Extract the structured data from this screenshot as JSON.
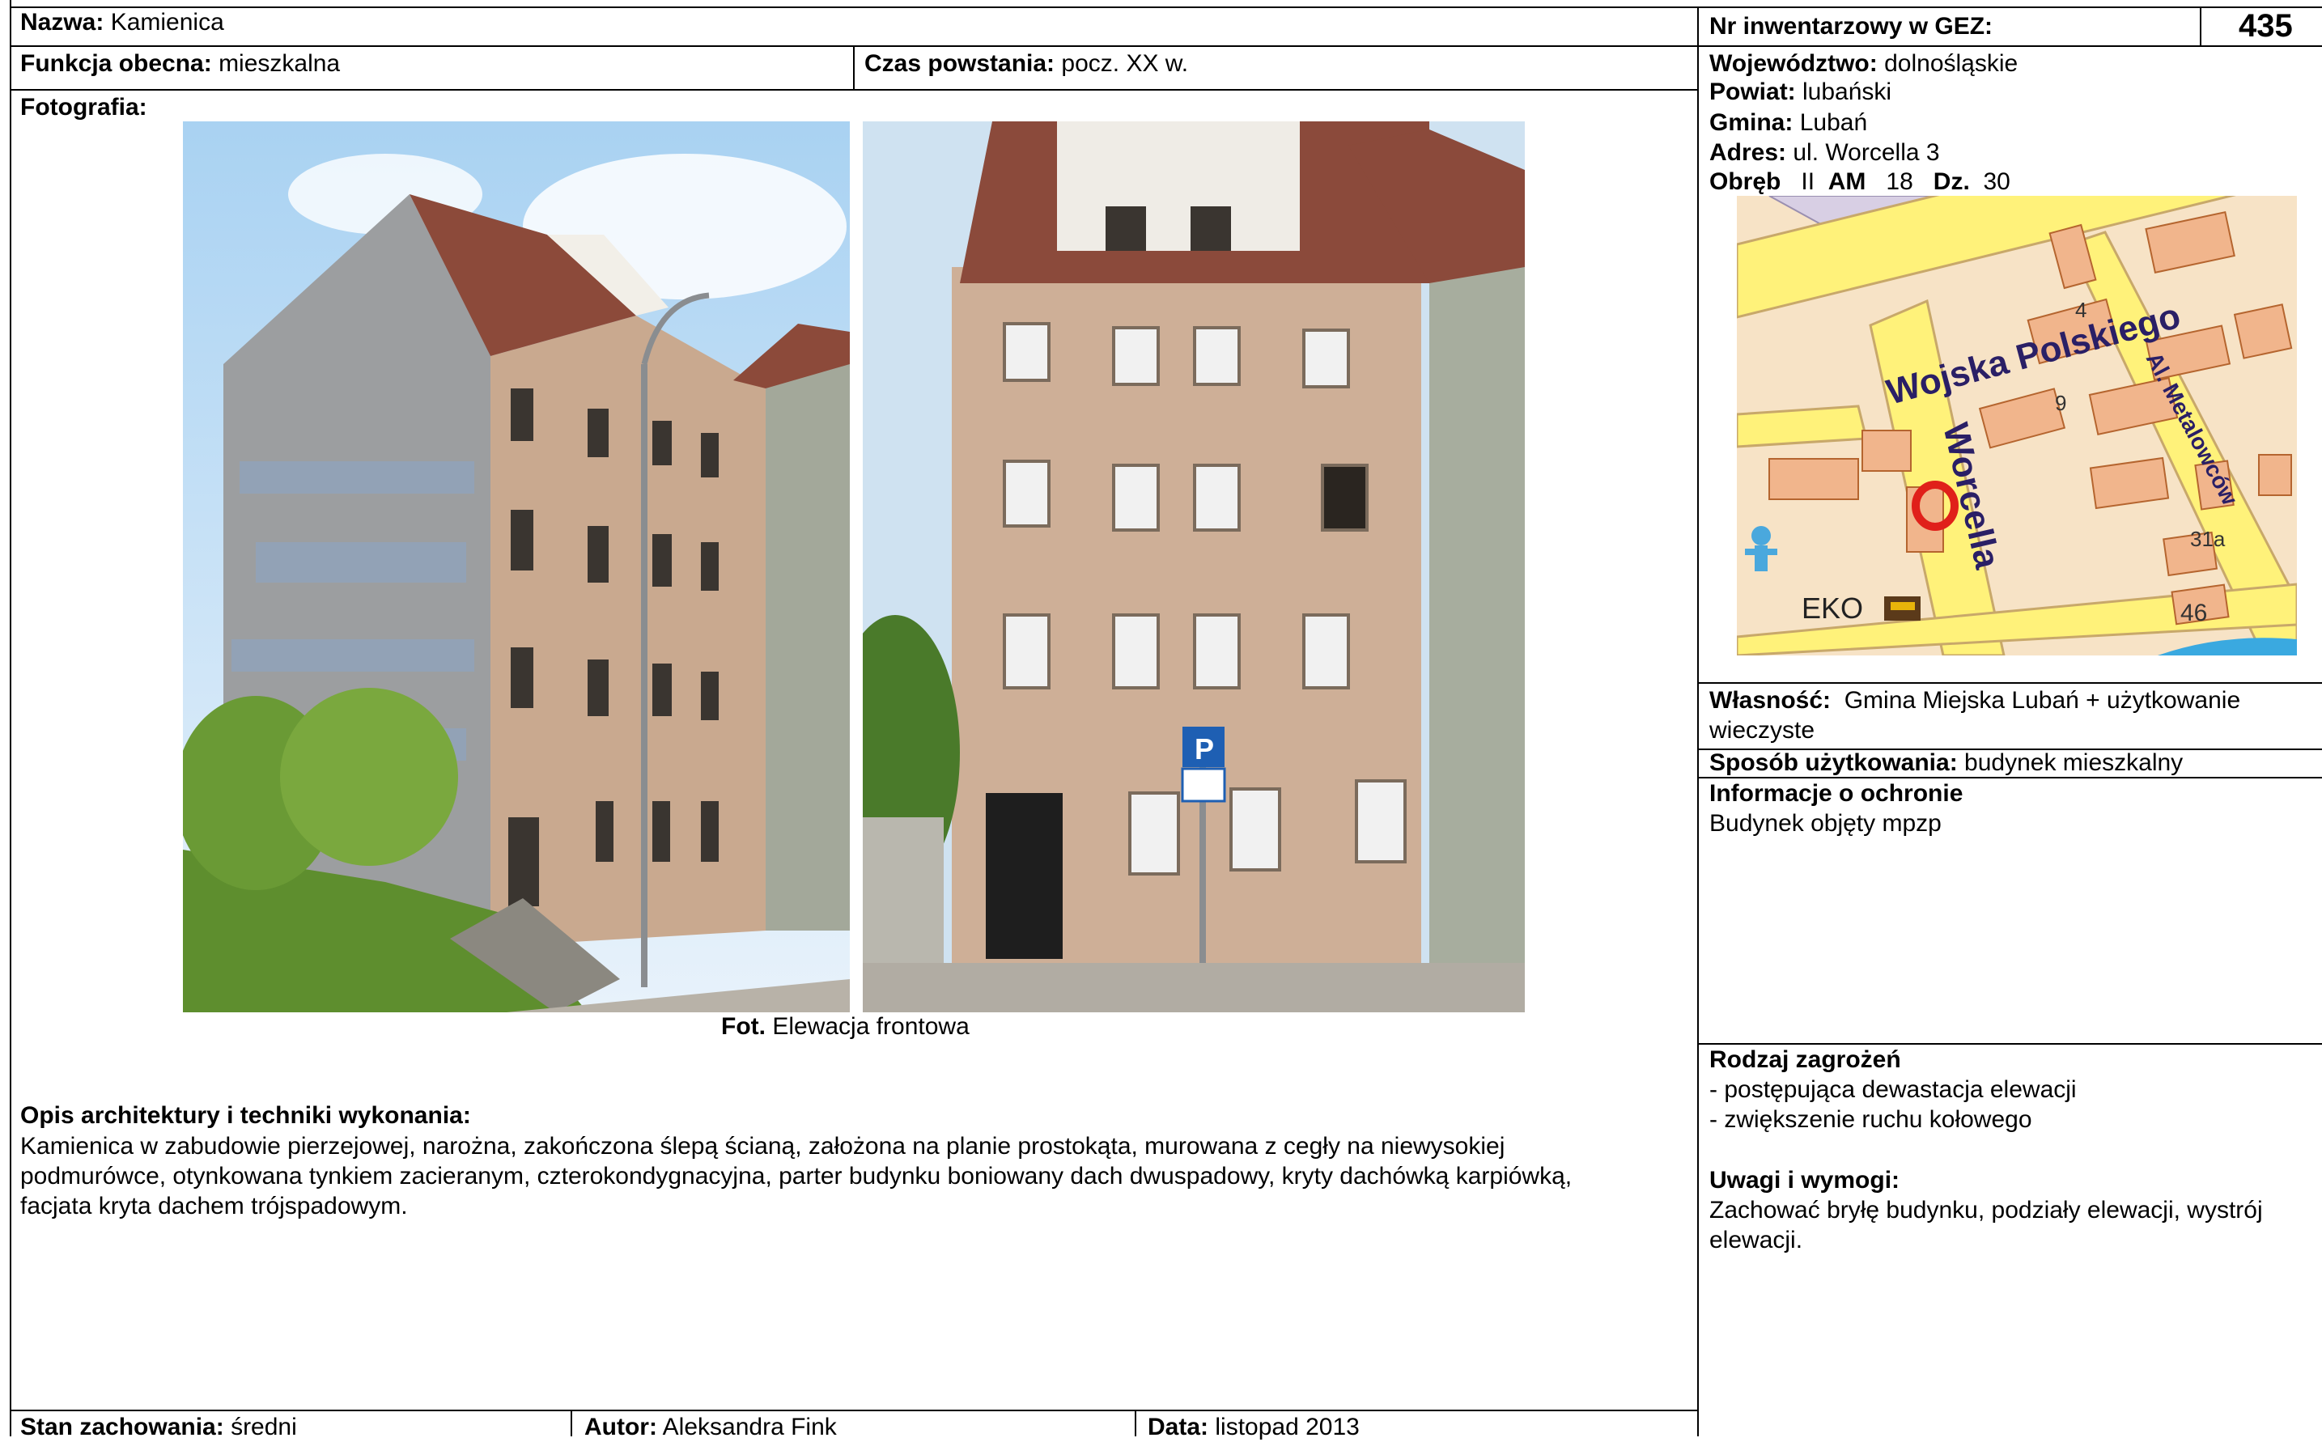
{
  "header": {
    "name_label": "Nazwa:",
    "name_value": "Kamienica",
    "inv_label": "Nr inwentarzowy w GEZ:",
    "inv_value": "435"
  },
  "row2": {
    "function_label": "Funkcja obecna:",
    "function_value": "mieszkalna",
    "time_label": "Czas powstania:",
    "time_value": "pocz. XX w."
  },
  "location": {
    "voivodeship_label": "Województwo:",
    "voivodeship_value": "dolnośląskie",
    "county_label": "Powiat:",
    "county_value": "lubański",
    "commune_label": "Gmina:",
    "commune_value": "Lubań",
    "address_label": "Adres:",
    "address_value": "ul. Worcella 3",
    "obreb_label": "Obręb",
    "obreb_value": "II",
    "am_label": "AM",
    "am_value": "18",
    "dz_label": "Dz.",
    "dz_value": "30"
  },
  "map": {
    "street1": "Wojska Polskiego",
    "street2": "Worcella",
    "street3": "Al. Metalowców",
    "num4": "4",
    "num9": "9",
    "num31a": "31a",
    "num46": "46",
    "eko": "EKO"
  },
  "photo_section": {
    "label": "Fotografia:",
    "caption_bold": "Fot.",
    "caption": "Elewacja frontowa"
  },
  "ownership": {
    "label": "Własność:",
    "value": "Gmina Miejska Lubań + użytkowanie wieczyste"
  },
  "usage": {
    "label": "Sposób użytkowania:",
    "value": "budynek mieszkalny"
  },
  "protection": {
    "label": "Informacje o ochronie",
    "value": "Budynek objęty mpzp"
  },
  "threats": {
    "label": "Rodzaj zagrożeń",
    "items": [
      "- postępująca dewastacja elewacji",
      "- zwiększenie ruchu kołowego"
    ]
  },
  "notes": {
    "label": "Uwagi i wymogi:",
    "value": "Zachować bryłę budynku, podziały elewacji, wystrój elewacji."
  },
  "description": {
    "label": "Opis architektury i techniki wykonania:",
    "lines": [
      "Kamienica w zabudowie pierzejowej, narożna, zakończona ślepą ścianą, założona na planie prostokąta, murowana z cegły na niewysokiej",
      "podmurówce, otynkowana tynkiem zacieranym, czterokondygnacyjna, parter budynku boniowany dach dwuspadowy, kryty dachówką karpiówką,",
      "facjata kryta dachem trójspadowym."
    ]
  },
  "footer": {
    "state_label": "Stan zachowania:",
    "state_value": "średni",
    "author_label": "Autor:",
    "author_value": "Aleksandra Fink",
    "date_label": "Data:",
    "date_value": "listopad 2013"
  }
}
